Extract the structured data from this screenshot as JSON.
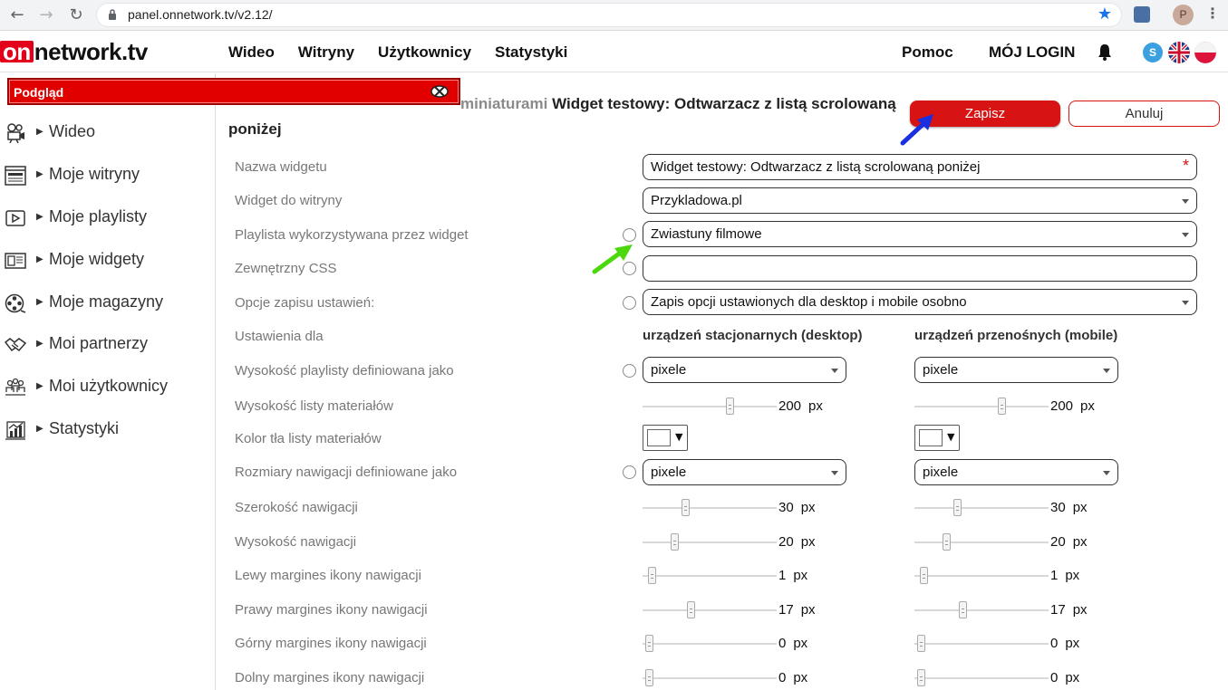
{
  "browser": {
    "url": "panel.onnetwork.tv/v2.12/",
    "profile_initial": "P"
  },
  "header": {
    "logo_on": "on",
    "logo_rest": "network.tv",
    "nav": [
      "Wideo",
      "Witryny",
      "Użytkownicy",
      "Statystyki"
    ],
    "help": "Pomoc",
    "login": "MÓJ LOGIN"
  },
  "sidebar": {
    "preview_label": "Podgląd",
    "items": [
      {
        "label": "Wideo",
        "icon": "camera-icon"
      },
      {
        "label": "Moje witryny",
        "icon": "website-icon"
      },
      {
        "label": "Moje playlisty",
        "icon": "playlist-icon"
      },
      {
        "label": "Moje widgety",
        "icon": "widget-icon"
      },
      {
        "label": "Moje magazyny",
        "icon": "film-reel-icon"
      },
      {
        "label": "Moi partnerzy",
        "icon": "handshake-icon"
      },
      {
        "label": "Moi użytkownicy",
        "icon": "users-icon"
      },
      {
        "label": "Statystyki",
        "icon": "stats-icon"
      }
    ]
  },
  "page": {
    "crumb": "miniaturami",
    "title": "Widget testowy: Odtwarzacz z listą scrolowaną poniżej",
    "save": "Zapisz",
    "cancel": "Anuluj"
  },
  "form": {
    "widget_name_label": "Nazwa widgetu",
    "widget_name_value": "Widget testowy:  Odtwarzacz z listą scrolowaną poniżej",
    "required_mark": "*",
    "site_label": "Widget do witryny",
    "site_value": "Przykladowa.pl",
    "playlist_label": "Playlista wykorzystywana przez widget",
    "playlist_value": "Zwiastuny filmowe",
    "css_label": "Zewnętrzny CSS",
    "css_value": "",
    "save_opts_label": "Opcje zapisu ustawień:",
    "save_opts_value": "Zapis opcji ustawionych dla desktop i mobile osobno",
    "settings_for_label": "Ustawienia dla",
    "col_desktop": "urządzeń stacjonarnych (desktop)",
    "col_mobile": "urządzeń przenośnych (mobile)",
    "playlist_height_label": "Wysokość playlisty definiowana jako",
    "playlist_height_desktop": "pixele",
    "playlist_height_mobile": "pixele",
    "list_height_label": "Wysokość listy materiałów",
    "list_bg_label": "Kolor tła listy materiałów",
    "nav_size_label": "Rozmiary nawigacji definiowane jako",
    "nav_size_desktop": "pixele",
    "nav_size_mobile": "pixele",
    "unit": "px",
    "sliders": [
      {
        "label": "Wysokość listy materiałów",
        "desktop": "200",
        "mobile": "200",
        "desktop_pos": 0.66,
        "mobile_pos": 0.66
      },
      {
        "label": "Szerokość nawigacji",
        "desktop": "30",
        "mobile": "30",
        "desktop_pos": 0.31,
        "mobile_pos": 0.31
      },
      {
        "label": "Wysokość nawigacji",
        "desktop": "20",
        "mobile": "20",
        "desktop_pos": 0.22,
        "mobile_pos": 0.22
      },
      {
        "label": "Lewy margines ikony nawigacji",
        "desktop": "1",
        "mobile": "1",
        "desktop_pos": 0.04,
        "mobile_pos": 0.04
      },
      {
        "label": "Prawy margines ikony nawigacji",
        "desktop": "17",
        "mobile": "17",
        "desktop_pos": 0.35,
        "mobile_pos": 0.35
      },
      {
        "label": "Górny margines ikony nawigacji",
        "desktop": "0",
        "mobile": "0",
        "desktop_pos": 0.02,
        "mobile_pos": 0.02
      },
      {
        "label": "Dolny margines ikony nawigacji",
        "desktop": "0",
        "mobile": "0",
        "desktop_pos": 0.02,
        "mobile_pos": 0.02
      }
    ]
  },
  "colors": {
    "brand_red": "#e2001a",
    "save_red": "#d71313",
    "annotation_blue": "#1a2fe0",
    "annotation_green": "#4cd80c"
  }
}
